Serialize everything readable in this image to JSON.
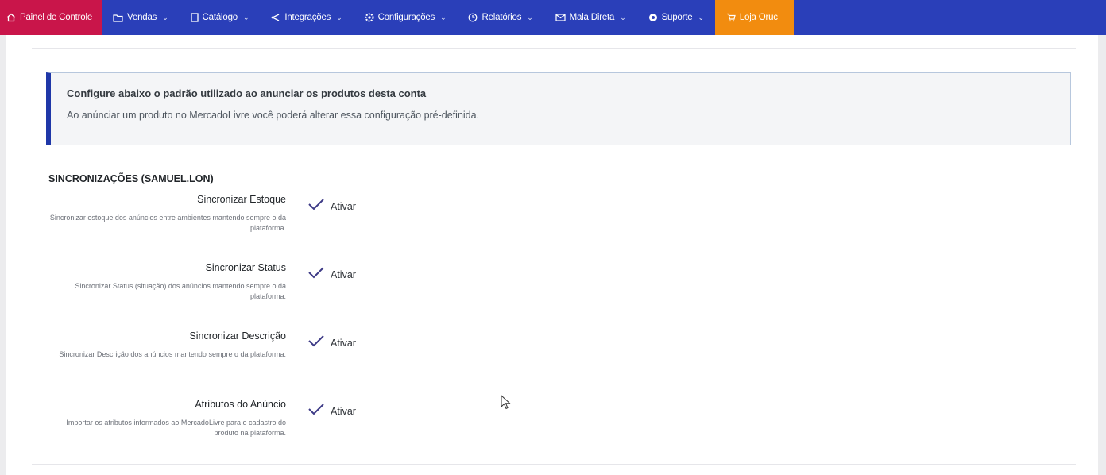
{
  "nav": {
    "home": "Painel de Controle",
    "vendas": "Vendas",
    "catalogo": "Catálogo",
    "integracoes": "Integrações",
    "configuracoes": "Configurações",
    "relatorios": "Relatórios",
    "mala_direta": "Mala Direta",
    "suporte": "Suporte",
    "loja": "Loja Oruc"
  },
  "callout": {
    "title": "Configure abaixo o padrão utilizado ao anunciar os produtos desta conta",
    "text": "Ao anúnciar um produto no MercadoLivre você poderá alterar essa configuração pré-definida."
  },
  "section_title": "SINCRONIZAÇÕES (SAMUEL.LON)",
  "sync_items": [
    {
      "label": "Sincronizar Estoque",
      "description": "Sincronizar estoque dos anúncios entre ambientes mantendo sempre o da plataforma.",
      "toggle_label": "Ativar"
    },
    {
      "label": "Sincronizar Status",
      "description": "Sincronizar Status (situação) dos anúncios mantendo sempre o da plataforma.",
      "toggle_label": "Ativar"
    },
    {
      "label": "Sincronizar Descrição",
      "description": "Sincronizar Descrição dos anúncios mantendo sempre o da plataforma.",
      "toggle_label": "Ativar"
    },
    {
      "label": "Atributos do Anúncio",
      "description": "Importar os atributos informados ao MercadoLivre para o cadastro do produto na plataforma.",
      "toggle_label": "Ativar"
    }
  ],
  "colors": {
    "navbar": "#2a3fb9",
    "home_tab": "#c9154a",
    "store_tab": "#f28c0f",
    "callout_accent": "#1f37a8",
    "check": "#3d3a86"
  }
}
